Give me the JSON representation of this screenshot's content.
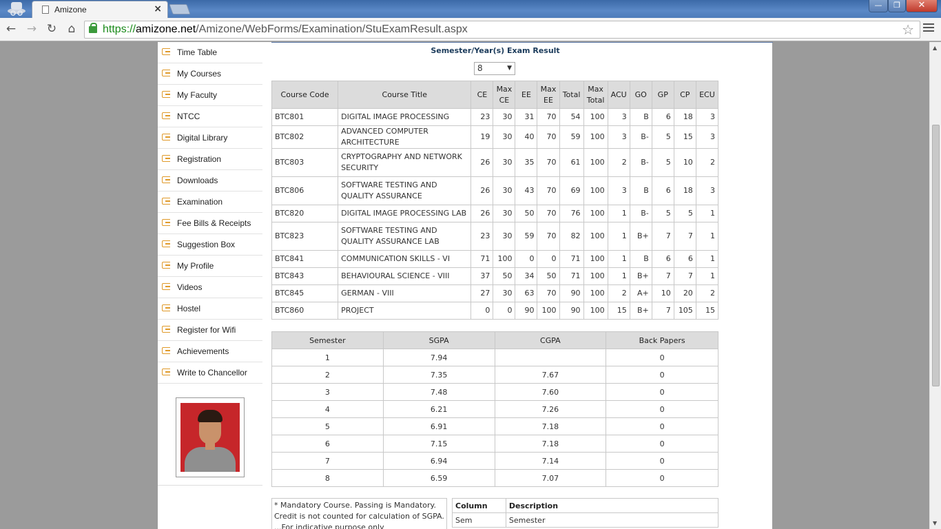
{
  "browser": {
    "tab_title": "Amizone",
    "tab_close": "×",
    "url_scheme": "https://",
    "url_domain": "amizone.net",
    "url_path": "/Amizone/WebForms/Examination/StuExamResult.aspx",
    "window_min": "—",
    "window_max": "❐",
    "window_close": "✕"
  },
  "sidebar": {
    "items": [
      {
        "label": "Time Table"
      },
      {
        "label": "My Courses"
      },
      {
        "label": "My Faculty"
      },
      {
        "label": "NTCC"
      },
      {
        "label": "Digital Library"
      },
      {
        "label": "Registration"
      },
      {
        "label": "Downloads"
      },
      {
        "label": "Examination"
      },
      {
        "label": "Fee Bills & Receipts"
      },
      {
        "label": "Suggestion Box"
      },
      {
        "label": "My Profile"
      },
      {
        "label": "Videos"
      },
      {
        "label": "Hostel"
      },
      {
        "label": "Register for Wifi"
      },
      {
        "label": "Achievements"
      },
      {
        "label": "Write to Chancellor"
      }
    ]
  },
  "main": {
    "heading": "Semester/Year(s) Exam Result",
    "semester_selected": "8",
    "results_headers": [
      "Course Code",
      "Course Title",
      "CE",
      "Max CE",
      "EE",
      "Max EE",
      "Total",
      "Max Total",
      "ACU",
      "GO",
      "GP",
      "CP",
      "ECU"
    ],
    "results_rows": [
      {
        "code": "BTC801",
        "title": "DIGITAL IMAGE PROCESSING",
        "ce": "23",
        "maxce": "30",
        "ee": "31",
        "maxee": "70",
        "total": "54",
        "maxtotal": "100",
        "acu": "3",
        "go": "B",
        "gp": "6",
        "cp": "18",
        "ecu": "3"
      },
      {
        "code": "BTC802",
        "title": "ADVANCED COMPUTER ARCHITECTURE",
        "ce": "19",
        "maxce": "30",
        "ee": "40",
        "maxee": "70",
        "total": "59",
        "maxtotal": "100",
        "acu": "3",
        "go": "B-",
        "gp": "5",
        "cp": "15",
        "ecu": "3"
      },
      {
        "code": "BTC803",
        "title": "CRYPTOGRAPHY AND NETWORK SECURITY",
        "ce": "26",
        "maxce": "30",
        "ee": "35",
        "maxee": "70",
        "total": "61",
        "maxtotal": "100",
        "acu": "2",
        "go": "B-",
        "gp": "5",
        "cp": "10",
        "ecu": "2"
      },
      {
        "code": "BTC806",
        "title": "SOFTWARE TESTING AND QUALITY ASSURANCE",
        "ce": "26",
        "maxce": "30",
        "ee": "43",
        "maxee": "70",
        "total": "69",
        "maxtotal": "100",
        "acu": "3",
        "go": "B",
        "gp": "6",
        "cp": "18",
        "ecu": "3"
      },
      {
        "code": "BTC820",
        "title": "DIGITAL IMAGE PROCESSING LAB",
        "ce": "26",
        "maxce": "30",
        "ee": "50",
        "maxee": "70",
        "total": "76",
        "maxtotal": "100",
        "acu": "1",
        "go": "B-",
        "gp": "5",
        "cp": "5",
        "ecu": "1"
      },
      {
        "code": "BTC823",
        "title": "SOFTWARE TESTING AND QUALITY ASSURANCE LAB",
        "ce": "23",
        "maxce": "30",
        "ee": "59",
        "maxee": "70",
        "total": "82",
        "maxtotal": "100",
        "acu": "1",
        "go": "B+",
        "gp": "7",
        "cp": "7",
        "ecu": "1"
      },
      {
        "code": "BTC841",
        "title": "COMMUNICATION SKILLS - VI",
        "ce": "71",
        "maxce": "100",
        "ee": "0",
        "maxee": "0",
        "total": "71",
        "maxtotal": "100",
        "acu": "1",
        "go": "B",
        "gp": "6",
        "cp": "6",
        "ecu": "1"
      },
      {
        "code": "BTC843",
        "title": "BEHAVIOURAL SCIENCE - VIII",
        "ce": "37",
        "maxce": "50",
        "ee": "34",
        "maxee": "50",
        "total": "71",
        "maxtotal": "100",
        "acu": "1",
        "go": "B+",
        "gp": "7",
        "cp": "7",
        "ecu": "1"
      },
      {
        "code": "BTC845",
        "title": "GERMAN - VIII",
        "ce": "27",
        "maxce": "30",
        "ee": "63",
        "maxee": "70",
        "total": "90",
        "maxtotal": "100",
        "acu": "2",
        "go": "A+",
        "gp": "10",
        "cp": "20",
        "ecu": "2"
      },
      {
        "code": "BTC860",
        "title": "PROJECT",
        "ce": "0",
        "maxce": "0",
        "ee": "90",
        "maxee": "100",
        "total": "90",
        "maxtotal": "100",
        "acu": "15",
        "go": "B+",
        "gp": "7",
        "cp": "105",
        "ecu": "15"
      }
    ],
    "gpa_headers": [
      "Semester",
      "SGPA",
      "CGPA",
      "Back Papers"
    ],
    "gpa_rows": [
      {
        "sem": "1",
        "sgpa": "7.94",
        "cgpa": "",
        "back": "0"
      },
      {
        "sem": "2",
        "sgpa": "7.35",
        "cgpa": "7.67",
        "back": "0"
      },
      {
        "sem": "3",
        "sgpa": "7.48",
        "cgpa": "7.60",
        "back": "0"
      },
      {
        "sem": "4",
        "sgpa": "6.21",
        "cgpa": "7.26",
        "back": "0"
      },
      {
        "sem": "5",
        "sgpa": "6.91",
        "cgpa": "7.18",
        "back": "0"
      },
      {
        "sem": "6",
        "sgpa": "7.15",
        "cgpa": "7.18",
        "back": "0"
      },
      {
        "sem": "7",
        "sgpa": "6.94",
        "cgpa": "7.14",
        "back": "0"
      },
      {
        "sem": "8",
        "sgpa": "6.59",
        "cgpa": "7.07",
        "back": "0"
      }
    ],
    "note_text": "* Mandatory Course. Passing is Mandatory. Credit is not counted for calculation of SGPA. ...For indicative purpose only",
    "legend_headers": [
      "Column",
      "Description"
    ],
    "legend_rows": [
      {
        "col": "Sem",
        "desc": "Semester"
      }
    ]
  }
}
